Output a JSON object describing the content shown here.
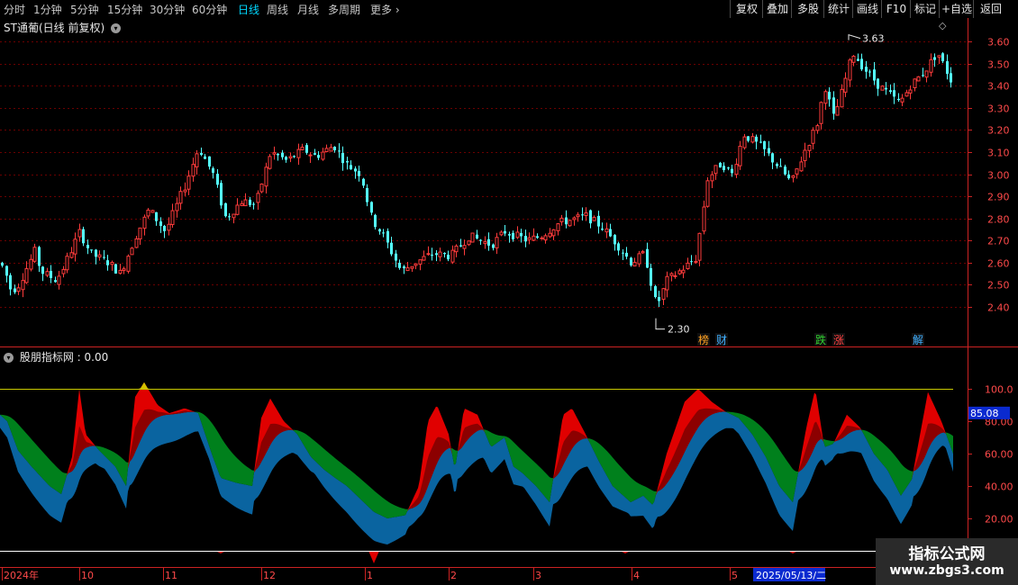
{
  "toolbar": {
    "periods": [
      {
        "label": "分时",
        "active": false
      },
      {
        "label": "1分钟",
        "active": false
      },
      {
        "label": "5分钟",
        "active": false
      },
      {
        "label": "15分钟",
        "active": false
      },
      {
        "label": "30分钟",
        "active": false
      },
      {
        "label": "60分钟",
        "active": false
      },
      {
        "label": "日线",
        "active": true
      },
      {
        "label": "周线",
        "active": false
      },
      {
        "label": "月线",
        "active": false
      },
      {
        "label": "多周期",
        "active": false
      },
      {
        "label": "更多",
        "active": false
      }
    ],
    "more_chevron": "chevron-right-icon",
    "actions": [
      "复权",
      "叠加",
      "多股",
      "统计",
      "画线",
      "F10",
      "标记",
      "+自选",
      "返回"
    ]
  },
  "main_panel": {
    "stock_title": "ST通葡(日线 前复权)",
    "dropdown_icon": "chevron-down-circle-icon",
    "diamond_icon": "diamond-icon",
    "price_axis": [
      "3.60",
      "3.50",
      "3.40",
      "3.30",
      "3.20",
      "3.10",
      "3.00",
      "2.90",
      "2.80",
      "2.70",
      "2.60",
      "2.50",
      "2.40"
    ],
    "price_range": [
      2.3,
      3.63
    ],
    "high_label": "3.63",
    "low_label": "2.30",
    "event_marks": [
      {
        "text": "榜",
        "color": "#ffa020"
      },
      {
        "text": "财",
        "color": "#40b0ff"
      },
      {
        "text": "跌",
        "color": "#30d030"
      },
      {
        "text": "涨",
        "color": "#ff4040"
      },
      {
        "text": "解",
        "color": "#40b0ff"
      }
    ],
    "colors": {
      "up": "#ff3b3b",
      "down": "#54ffff",
      "grid": "#6a0000",
      "axis": "#cc2222"
    }
  },
  "indicator_panel": {
    "title": "股朋指标网",
    "value": ": 0.00",
    "indicator_axis": [
      "100.0",
      "80.00",
      "60.00",
      "40.00",
      "20.00"
    ],
    "current_value": "85.08",
    "upper_line": 100,
    "lower_line": 0,
    "colors": {
      "red": "#e00000",
      "darkred": "#8c0000",
      "green": "#00801c",
      "blue": "#0a64a0",
      "yellow": "#d4c000",
      "upper_line": "#c8c800",
      "lower_line": "#ffffff"
    }
  },
  "time_axis": {
    "labels": [
      "2024年",
      "10",
      "11",
      "12",
      "1",
      "2",
      "3",
      "4",
      "5"
    ],
    "cursor_date": "2025/05/13/二"
  },
  "watermark": {
    "title": "指标公式网",
    "url": "www.zbgs3.com"
  }
}
